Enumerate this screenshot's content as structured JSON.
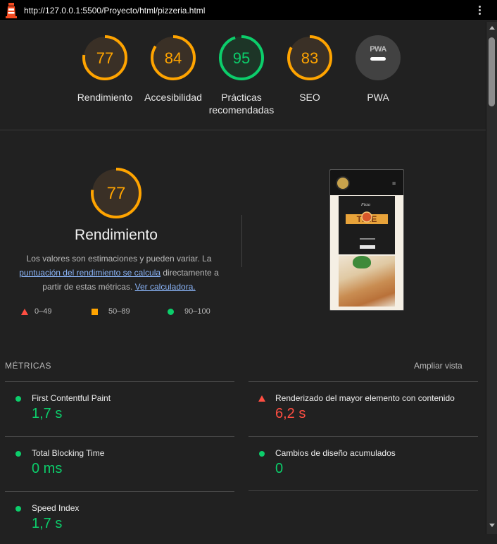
{
  "browser": {
    "url": "http://127.0.0.1:5500/Proyecto/html/pizzeria.html"
  },
  "scores": [
    {
      "key": "performance",
      "value": "77",
      "label": "Rendimiento",
      "fraction": 0.77,
      "color": "#ffa400"
    },
    {
      "key": "accessibility",
      "value": "84",
      "label": "Accesibilidad",
      "fraction": 0.84,
      "color": "#ffa400"
    },
    {
      "key": "best-practices",
      "value": "95",
      "label": "Prácticas recomendadas",
      "fraction": 0.95,
      "color": "#0cce6b"
    },
    {
      "key": "seo",
      "value": "83",
      "label": "SEO",
      "fraction": 0.83,
      "color": "#ffa400"
    },
    {
      "key": "pwa",
      "value": "PWA",
      "label": "PWA"
    }
  ],
  "performance": {
    "score": "77",
    "fraction": 0.77,
    "title": "Rendimiento",
    "desc_before": "Los valores son estimaciones y pueden variar. La ",
    "desc_link1": "puntuación del rendimiento se calcula",
    "desc_middle": " directamente a partir de estas métricas. ",
    "desc_link2": "Ver calculadora.",
    "legend": [
      {
        "shape": "triangle",
        "text": "0–49",
        "color": "#ff4e42"
      },
      {
        "shape": "square",
        "text": "50–89",
        "color": "#ffa400"
      },
      {
        "shape": "circle",
        "text": "90–100",
        "color": "#0cce6b"
      }
    ]
  },
  "metrics": {
    "heading": "MÉTRICAS",
    "expand_label": "Ampliar vista",
    "items": [
      {
        "name": "First Contentful Paint",
        "value": "1,7 s",
        "status": "pass"
      },
      {
        "name": "Renderizado del mayor elemento con contenido",
        "value": "6,2 s",
        "status": "fail"
      },
      {
        "name": "Total Blocking Time",
        "value": "0 ms",
        "status": "pass"
      },
      {
        "name": "Cambios de diseño acumulados",
        "value": "0",
        "status": "pass"
      },
      {
        "name": "Speed Index",
        "value": "1,7 s",
        "status": "pass"
      }
    ]
  },
  "thumbnail": {
    "menu_glyph": "≡",
    "hero_word": "TIME",
    "hero_small": "Pizza"
  },
  "colors": {
    "pass": "#0cce6b",
    "average": "#ffa400",
    "fail": "#ff4e42",
    "link": "#8ab4f8"
  }
}
